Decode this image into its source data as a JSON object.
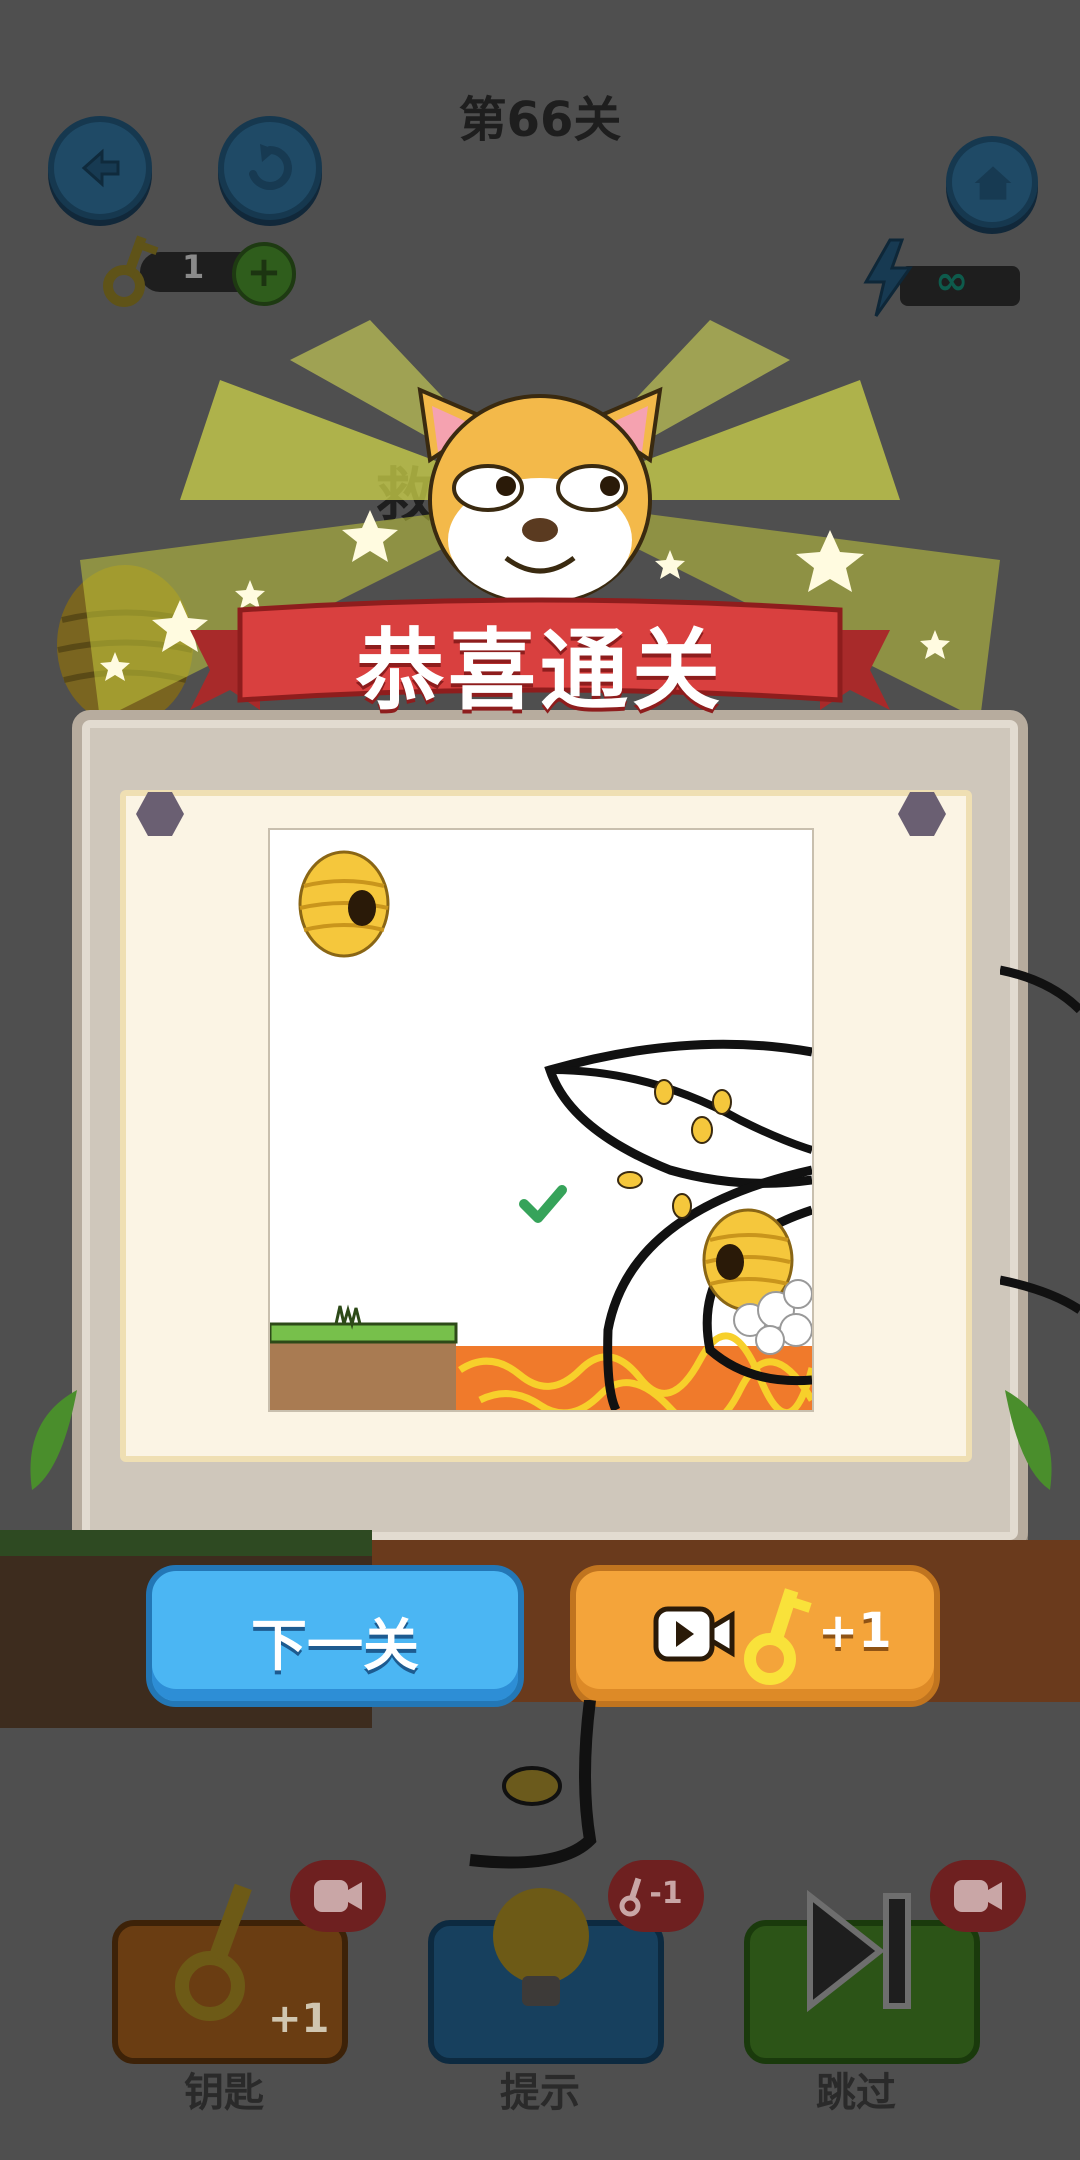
{
  "level": {
    "title": "第66关"
  },
  "top_bar": {
    "back_icon": "back-arrow-icon",
    "restart_icon": "restart-icon",
    "home_icon": "home-icon",
    "keys_count": "1",
    "energy_value": "∞"
  },
  "hidden_text": "救",
  "result_popup": {
    "banner_text": "恭喜通关",
    "next_button": "下一关",
    "video_reward_label": "+1"
  },
  "tools": [
    {
      "label": "钥匙",
      "badge": "+1",
      "bubble": "video"
    },
    {
      "label": "提示",
      "badge": "-1",
      "bubble": "key"
    },
    {
      "label": "跳过",
      "badge": "",
      "bubble": "video"
    }
  ],
  "colors": {
    "banner_red": "#d9403f",
    "next_blue": "#4bb6f3",
    "video_orange": "#f4a43a",
    "lava": "#f07a2b",
    "grass": "#77c04b"
  }
}
